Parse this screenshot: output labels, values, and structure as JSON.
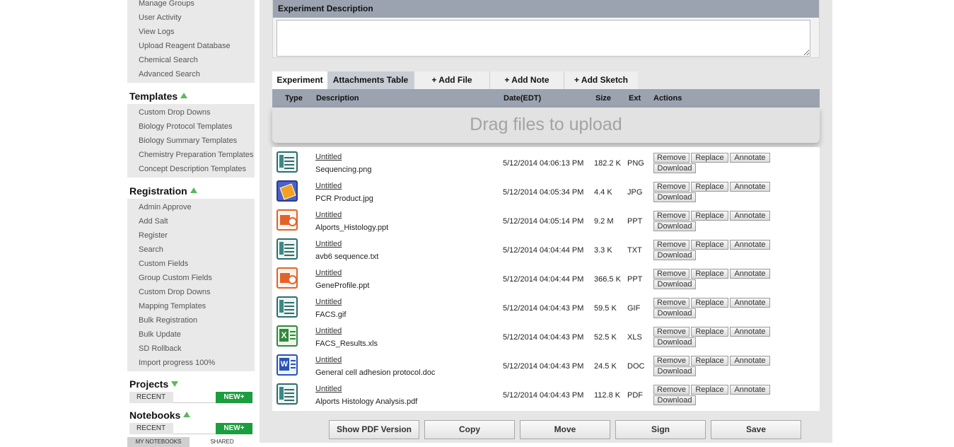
{
  "sidebar": {
    "admin_items": [
      "Manage Groups",
      "User Activity",
      "View Logs",
      "Upload Reagent Database",
      "Chemical Search",
      "Advanced Search"
    ],
    "templates": {
      "title": "Templates",
      "items": [
        "Custom Drop Downs",
        "Biology Protocol Templates",
        "Biology Summary Templates",
        "Chemistry Preparation Templates",
        "Concept Description Templates"
      ]
    },
    "registration": {
      "title": "Registration",
      "items": [
        "Admin Approve",
        "Add Salt",
        "Register",
        "Search",
        "Custom Fields",
        "Group Custom Fields",
        "Custom Drop Downs",
        "Mapping Templates",
        "Bulk Registration",
        "Bulk Update",
        "SD Rollback",
        "Import progress 100%"
      ]
    },
    "projects": {
      "title": "Projects",
      "recent": "RECENT",
      "new": "NEW+"
    },
    "notebooks": {
      "title": "Notebooks",
      "recent": "RECENT",
      "new": "NEW+",
      "tab_mine": "MY NOTEBOOKS",
      "tab_shared": "SHARED"
    }
  },
  "experiment_description": {
    "header": "Experiment Description",
    "value": ""
  },
  "tabs": [
    {
      "label": "Experiment",
      "active": false
    },
    {
      "label": "Attachments Table",
      "active": true
    },
    {
      "label": "+ Add File"
    },
    {
      "label": "+ Add Note"
    },
    {
      "label": "+ Add Sketch"
    }
  ],
  "table": {
    "headers": {
      "type": "Type",
      "description": "Description",
      "date": "Date(EDT)",
      "size": "Size",
      "ext": "Ext",
      "actions": "Actions"
    },
    "drop_zone": "Drag files to upload",
    "action_labels": {
      "remove": "Remove",
      "replace": "Replace",
      "annotate": "Annotate",
      "download": "Download"
    },
    "rows": [
      {
        "icon": "document-icon",
        "link": "Untitled",
        "filename": "Sequencing.png",
        "date": "5/12/2014 04:06:13 PM",
        "size": "182.2 K",
        "ext": "PNG"
      },
      {
        "icon": "image-icon",
        "link": "Untitled",
        "filename": "PCR Product.jpg",
        "date": "5/12/2014 04:05:34 PM",
        "size": "4.4 K",
        "ext": "JPG"
      },
      {
        "icon": "powerpoint-icon",
        "link": "Untitled",
        "filename": "Alports_Histology.ppt",
        "date": "5/12/2014 04:05:14 PM",
        "size": "9.2 M",
        "ext": "PPT"
      },
      {
        "icon": "document-icon",
        "link": "Untitled",
        "filename": "avb6 sequence.txt",
        "date": "5/12/2014 04:04:44 PM",
        "size": "3.3 K",
        "ext": "TXT"
      },
      {
        "icon": "powerpoint-icon",
        "link": "Untitled",
        "filename": "GeneProfile.ppt",
        "date": "5/12/2014 04:04:44 PM",
        "size": "366.5 K",
        "ext": "PPT"
      },
      {
        "icon": "document-icon",
        "link": "Untitled",
        "filename": "FACS.gif",
        "date": "5/12/2014 04:04:43 PM",
        "size": "59.5 K",
        "ext": "GIF"
      },
      {
        "icon": "excel-icon",
        "link": "Untitled",
        "filename": "FACS_Results.xls",
        "date": "5/12/2014 04:04:43 PM",
        "size": "52.5 K",
        "ext": "XLS"
      },
      {
        "icon": "word-icon",
        "link": "Untitled",
        "filename": "General cell adhesion protocol.doc",
        "date": "5/12/2014 04:04:43 PM",
        "size": "24.5 K",
        "ext": "DOC"
      },
      {
        "icon": "document-icon",
        "link": "Untitled",
        "filename": "Alports Histology Analysis.pdf",
        "date": "5/12/2014 04:04:43 PM",
        "size": "112.8 K",
        "ext": "PDF"
      }
    ]
  },
  "bottom_buttons": [
    "Show PDF Version",
    "Copy",
    "Move",
    "Sign",
    "Save"
  ],
  "colors": {
    "header_bar": "#9ca3b0",
    "new_button": "#1a9e3e",
    "arrow": "#5cb85c",
    "panel_bg": "#e6e6e6"
  }
}
